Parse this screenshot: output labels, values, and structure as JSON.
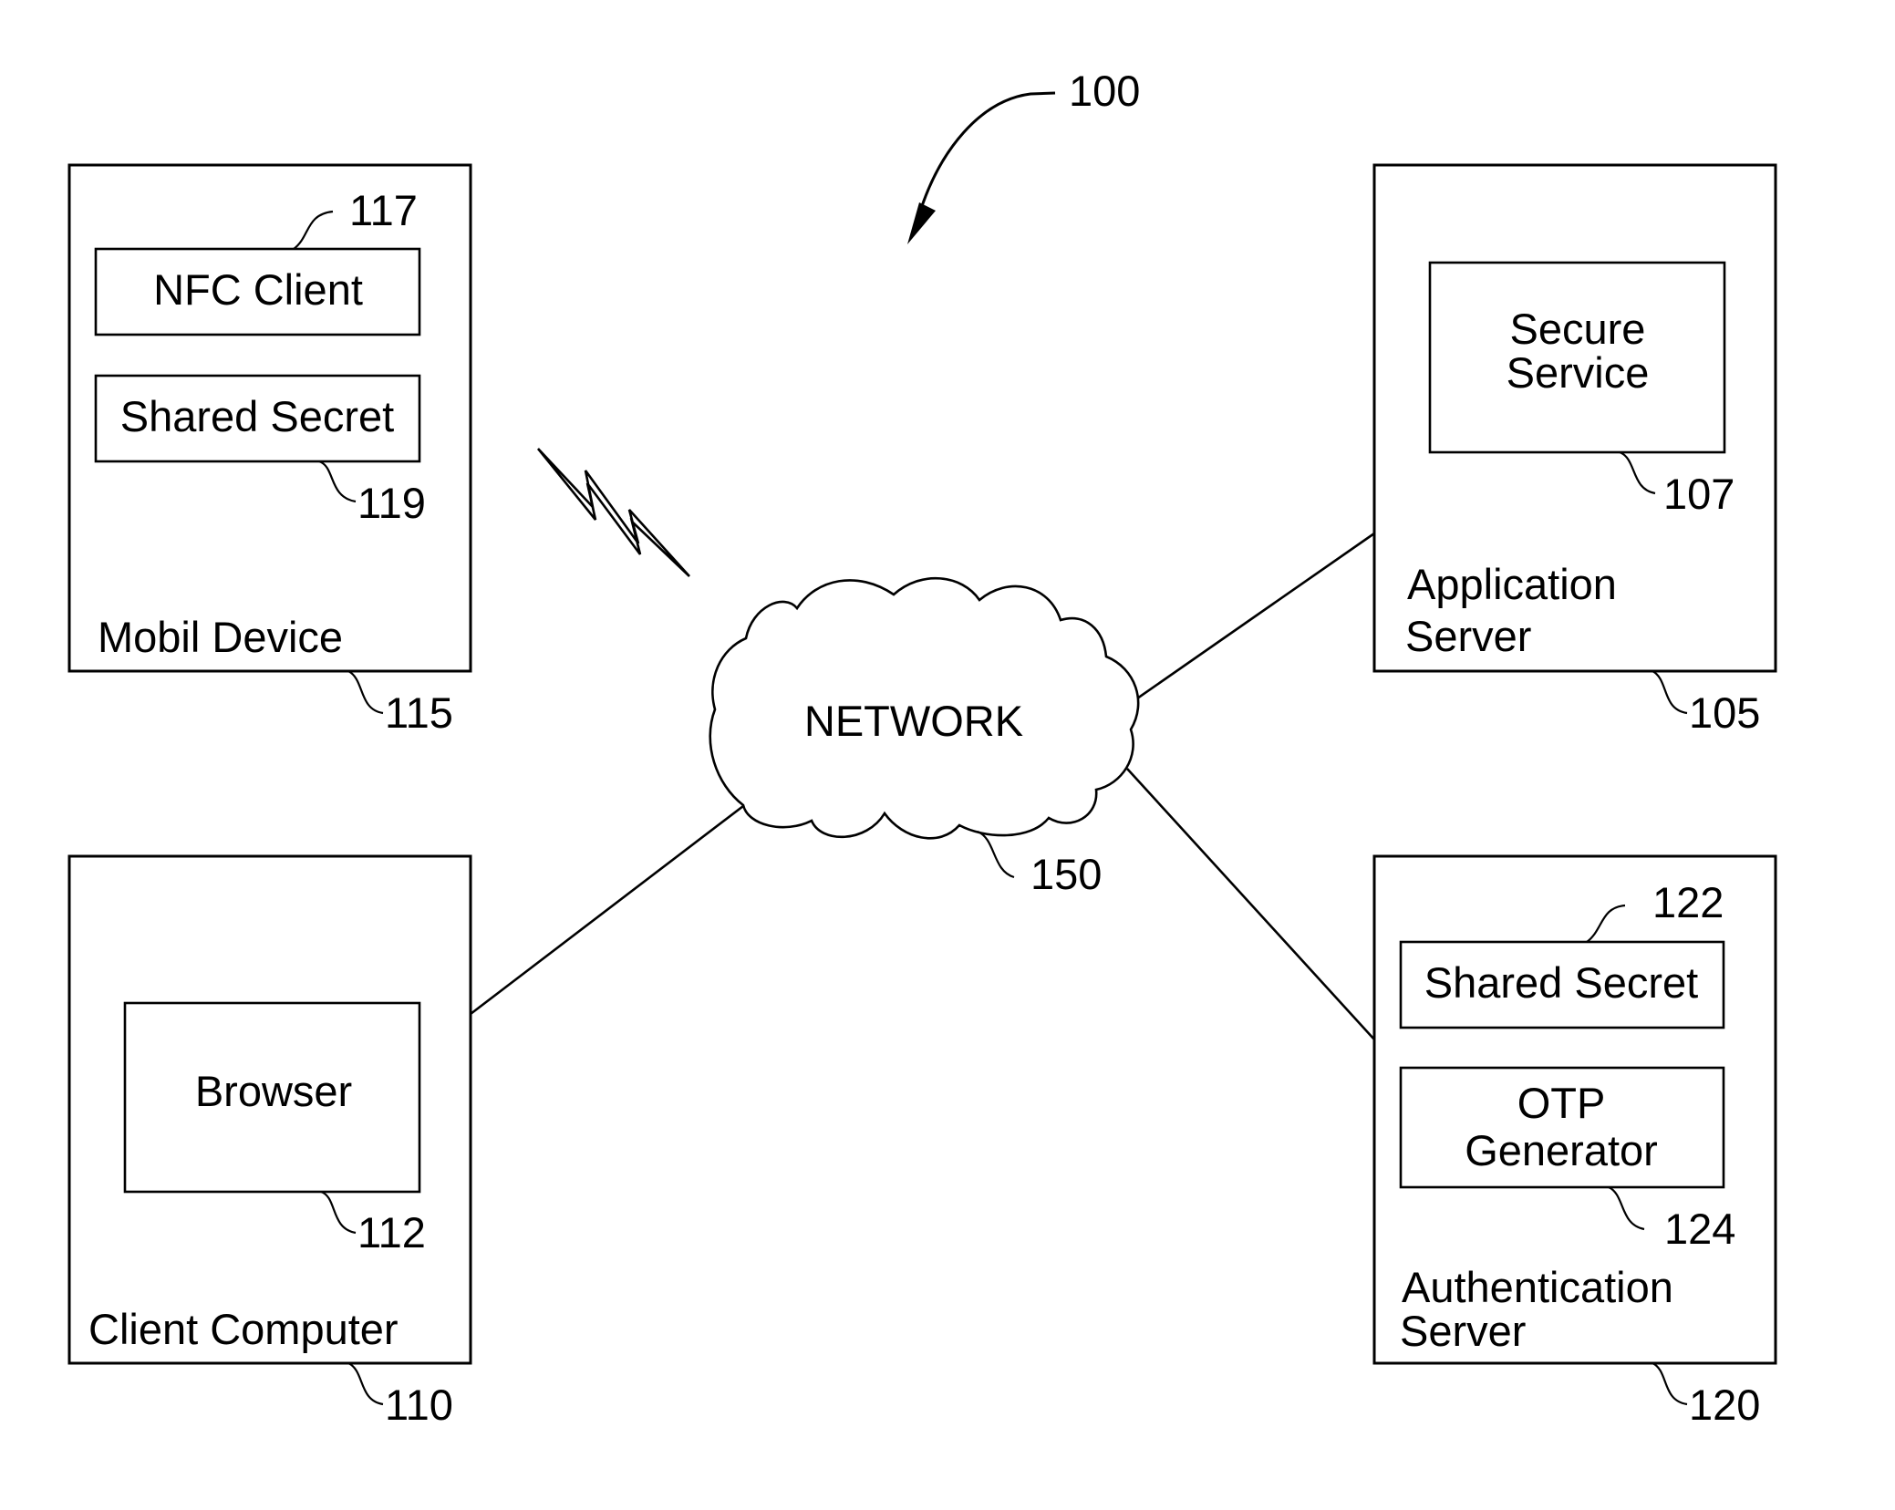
{
  "figure": {
    "reference": "100",
    "network": {
      "label": "NETWORK",
      "reference": "150"
    },
    "nodes": {
      "mobile_device": {
        "label": "Mobil Device",
        "reference": "115",
        "components": [
          {
            "label": "NFC Client",
            "reference": "117"
          },
          {
            "label": "Shared Secret",
            "reference": "119"
          }
        ]
      },
      "client_computer": {
        "label": "Client Computer",
        "reference": "110",
        "components": [
          {
            "label": "Browser",
            "reference": "112"
          }
        ]
      },
      "application_server": {
        "label_lines": [
          "Application",
          "Server"
        ],
        "reference": "105",
        "components": [
          {
            "label_lines": [
              "Secure",
              "Service"
            ],
            "reference": "107"
          }
        ]
      },
      "authentication_server": {
        "label_lines": [
          "Authentication",
          "Server"
        ],
        "reference": "120",
        "components": [
          {
            "label": "Shared Secret",
            "reference": "122"
          },
          {
            "label_lines": [
              "OTP",
              "Generator"
            ],
            "reference": "124"
          }
        ]
      }
    },
    "connections": [
      {
        "from": "client_computer",
        "to": "network",
        "type": "wired"
      },
      {
        "from": "network",
        "to": "application_server",
        "type": "wired"
      },
      {
        "from": "network",
        "to": "authentication_server",
        "type": "wired"
      },
      {
        "from": "mobile_device",
        "to": "network",
        "type": "wireless"
      }
    ]
  }
}
